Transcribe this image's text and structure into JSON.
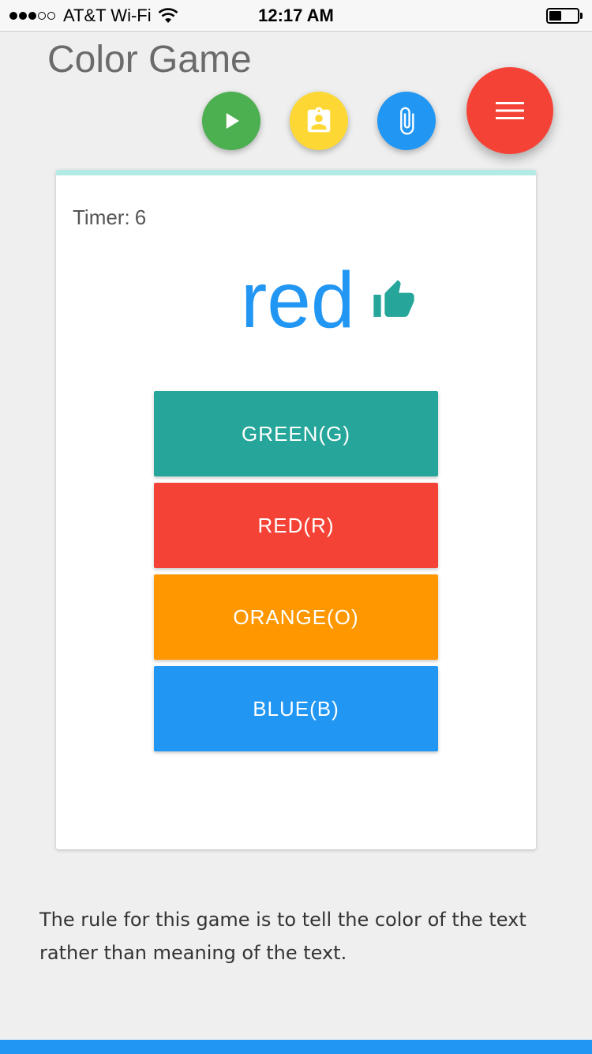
{
  "status_bar": {
    "carrier": "AT&T Wi-Fi",
    "time": "12:17 AM",
    "signal_bars_filled": 3,
    "signal_bars_total": 5,
    "battery_level_fraction": 0.45
  },
  "app": {
    "title": "Color Game"
  },
  "actions": {
    "play_icon": "play-icon",
    "contact_icon": "contact-clipboard-icon",
    "attach_icon": "paperclip-icon",
    "menu_icon": "menu-icon",
    "colors": {
      "play": "#4caf50",
      "contact": "#fdd835",
      "attach": "#2196f3",
      "menu": "#f44336"
    }
  },
  "game": {
    "timer_label": "Timer:",
    "timer_value": "6",
    "word": "red",
    "word_color": "#2196f3",
    "feedback_icon": "thumbs-up-icon",
    "feedback_color": "#26a69a",
    "answers": [
      {
        "label": "GREEN(G)",
        "color": "#26a69a"
      },
      {
        "label": "RED(R)",
        "color": "#f44336"
      },
      {
        "label": "ORANGE(O)",
        "color": "#ff9800"
      },
      {
        "label": "BLUE(B)",
        "color": "#2196f3"
      }
    ]
  },
  "rule_text": "The rule for this game is to tell the color of the text rather than meaning of the text."
}
